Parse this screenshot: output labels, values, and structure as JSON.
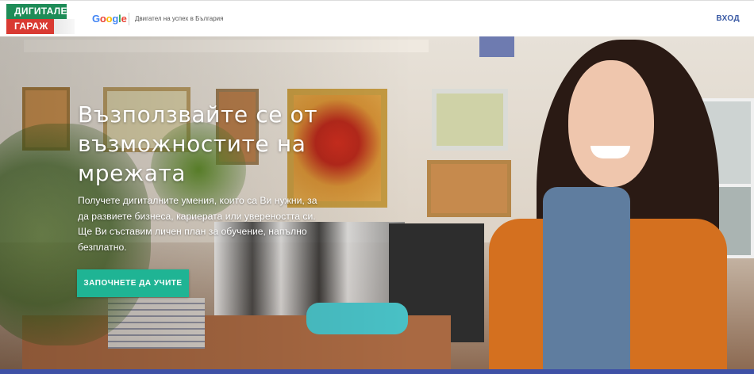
{
  "header": {
    "logo": {
      "line1": "ДИГИТАЛЕН",
      "line2": "ГАРАЖ",
      "colors": {
        "top": "#1e8c57",
        "bottom": "#d93a32"
      }
    },
    "google_word": [
      "G",
      "o",
      "o",
      "g",
      "l",
      "e"
    ],
    "tagline": "Двигател на успех в България",
    "login_label": "ВХОД"
  },
  "hero": {
    "title": "Възползвайте се от възможностите на мрежата",
    "description": "Получете дигиталните умения, които са Ви нужни, за да развиете бизнеса, кариерата или увереността си. Ще Ви съставим личен план за обучение, напълно безплатно.",
    "cta_label": "ЗАПОЧНЕТЕ ДА УЧИТЕ",
    "cta_color": "#1fb494"
  },
  "colors": {
    "accent": "#3b5ba5",
    "bottom_strip": "#3f51a6"
  }
}
